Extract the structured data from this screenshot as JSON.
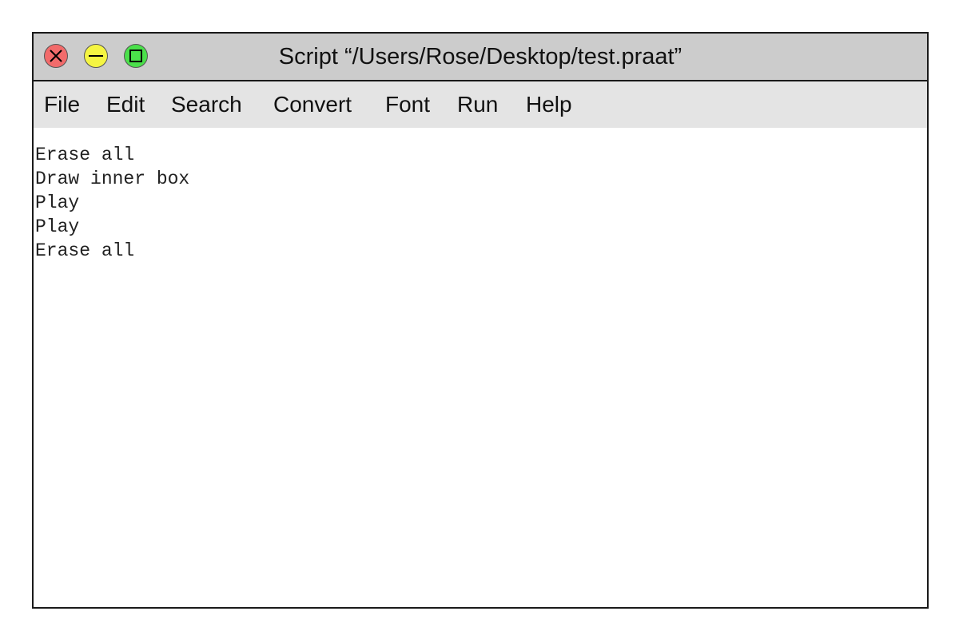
{
  "window": {
    "title": "Script “/Users/Rose/Desktop/test.praat”",
    "controls": {
      "close_icon": "close-x-icon",
      "minimize_icon": "minimize-dash-icon",
      "maximize_icon": "maximize-square-icon",
      "colors": {
        "close": "#f26b6b",
        "minimize": "#f5f542",
        "maximize": "#4be04b"
      }
    }
  },
  "menu": {
    "items": [
      "File",
      "Edit",
      "Search",
      "Convert",
      "Font",
      "Run",
      "Help"
    ]
  },
  "editor": {
    "lines": [
      "Erase all",
      "Draw inner box",
      "Play",
      "Play",
      "Erase all"
    ]
  }
}
